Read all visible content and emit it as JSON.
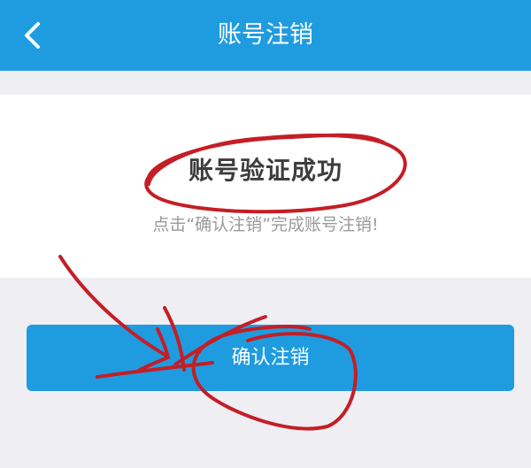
{
  "header": {
    "title": "账号注销",
    "back_icon": "chevron-left-icon",
    "background_color": "#1f9ce0"
  },
  "card": {
    "success_title": "账号验证成功",
    "hint": "点击“确认注销”完成账号注销!"
  },
  "actions": {
    "confirm_label": "确认注销",
    "button_color": "#1f9ce0"
  },
  "annotation_color": "#c41e26"
}
